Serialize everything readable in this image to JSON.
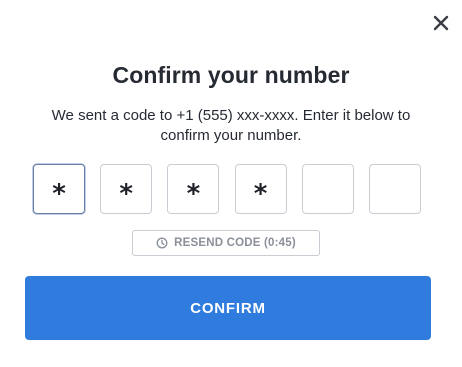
{
  "dialog": {
    "title": "Confirm your number",
    "subtitle": "We sent a code to +1 (555) xxx-xxxx. Enter it below to confirm your number.",
    "close_icon": "close-icon"
  },
  "code_inputs": [
    {
      "value": "*"
    },
    {
      "value": "*"
    },
    {
      "value": "*"
    },
    {
      "value": "*"
    },
    {
      "value": ""
    },
    {
      "value": ""
    }
  ],
  "resend": {
    "icon": "clock-icon",
    "label": "RESEND CODE (0:45)"
  },
  "confirm": {
    "label": "CONFIRM"
  },
  "colors": {
    "accent": "#2f7bde",
    "text": "#262a33",
    "muted": "#8a8f98",
    "border": "#c9cdd4"
  }
}
